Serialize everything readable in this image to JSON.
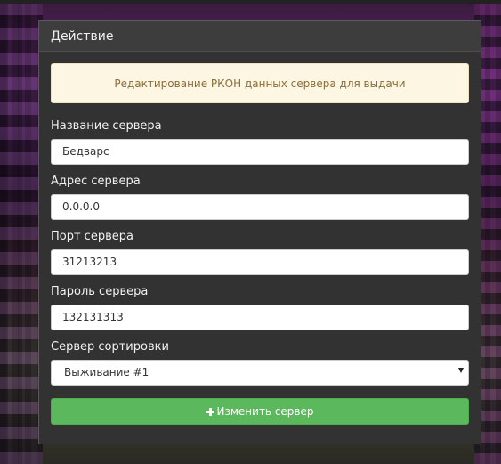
{
  "panel": {
    "title": "Действие",
    "alert_text": "Редактирование РКОН данных сервера для выдачи"
  },
  "form": {
    "server_name": {
      "label": "Название сервера",
      "value": "Бедварс"
    },
    "server_address": {
      "label": "Адрес сервера",
      "value": "0.0.0.0"
    },
    "server_port": {
      "label": "Порт сервера",
      "value": "31213213"
    },
    "server_password": {
      "label": "Пароль сервера",
      "value": "132131313"
    },
    "sort_server": {
      "label": "Сервер сортировки",
      "selected": "Выживание #1"
    },
    "submit_label": "Изменить сервер"
  },
  "icons": {
    "submit": "plus-icon",
    "select": "caret-down-icon"
  },
  "colors": {
    "success": "#5cb85c",
    "alert_bg": "#fdf6e3",
    "alert_text": "#8a6d3b",
    "panel_bg": "#323232"
  }
}
